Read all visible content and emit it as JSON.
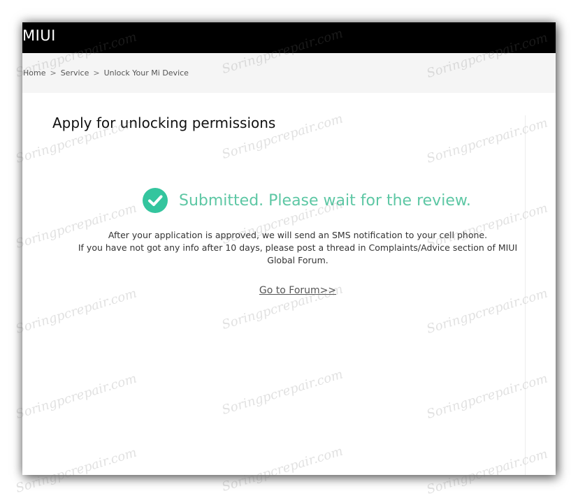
{
  "header": {
    "logo": "MIUI"
  },
  "breadcrumb": {
    "items": [
      "Home",
      "Service",
      "Unlock Your Mi Device"
    ],
    "separator": ">"
  },
  "main": {
    "title": "Apply for unlocking permissions",
    "status": {
      "icon": "check-circle-icon",
      "text": "Submitted. Please wait for the review.",
      "color": "#5dc7a4",
      "icon_color": "#34c59e"
    },
    "info_lines": [
      "After your application is approved, we will send an SMS notification to your cell phone.",
      "If you have not got any info after 10 days, please post a thread in Complaints/Advice section of MIUI Global Forum."
    ],
    "forum_link": "Go to Forum>>"
  },
  "watermark": {
    "text": "Soringpcrepair.com"
  },
  "colors": {
    "topbar": "#000000",
    "breadcrumb_bg": "#f5f5f5"
  }
}
